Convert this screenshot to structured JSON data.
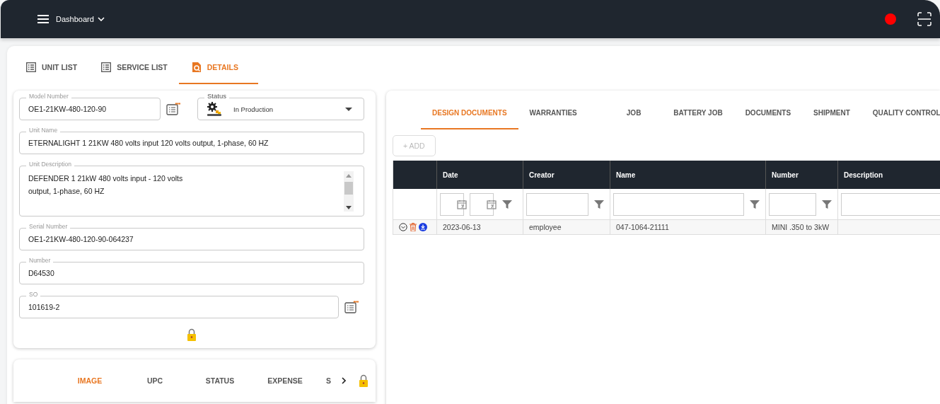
{
  "top_bar": {
    "menu_label": "Dashboard"
  },
  "tabs": [
    {
      "label": "UNIT LIST",
      "selected": false
    },
    {
      "label": "SERVICE LIST",
      "selected": false
    },
    {
      "label": "DETAILS",
      "selected": true
    }
  ],
  "unit_form": {
    "model_number": {
      "label": "Model Number",
      "value": "OE1-21KW-480-120-90"
    },
    "status": {
      "label": "Status",
      "value": "In Production"
    },
    "unit_name": {
      "label": "Unit Name",
      "value": "ETERNALIGHT 1 21KW 480 volts input 120 volts output, 1-phase, 60 HZ"
    },
    "unit_description": {
      "label": "Unit Description",
      "value": "DEFENDER 1 21kW 480 volts input - 120 volts output, 1-phase, 60 HZ"
    },
    "serial_number": {
      "label": "Serial Number",
      "value": "OE1-21KW-480-120-90-064237"
    },
    "number": {
      "label": "Number",
      "value": "D64530"
    },
    "so": {
      "label": "SO",
      "value": "101619-2"
    }
  },
  "sub_tabs": [
    {
      "label": "IMAGE",
      "selected": true
    },
    {
      "label": "UPC",
      "selected": false
    },
    {
      "label": "STATUS",
      "selected": false
    },
    {
      "label": "EXPENSE",
      "selected": false
    },
    {
      "label": "S",
      "selected": false
    }
  ],
  "doc_tabs": [
    {
      "label": "DESIGN DOCUMENTS",
      "selected": true
    },
    {
      "label": "WARRANTIES",
      "selected": false
    },
    {
      "label": "JOB",
      "selected": false
    },
    {
      "label": "BATTERY JOB",
      "selected": false
    },
    {
      "label": "DOCUMENTS",
      "selected": false
    },
    {
      "label": "SHIPMENT",
      "selected": false
    },
    {
      "label": "QUALITY CONTROL",
      "selected": false
    }
  ],
  "add_button": {
    "label": "+ ADD",
    "disabled": true
  },
  "table": {
    "columns": [
      "Date",
      "Creator",
      "Name",
      "Number",
      "Description"
    ],
    "rows": [
      {
        "cells": [
          "2023-06-13",
          "employee",
          "047-1064-21111",
          "MINI .350 to 3kW"
        ]
      }
    ]
  }
}
